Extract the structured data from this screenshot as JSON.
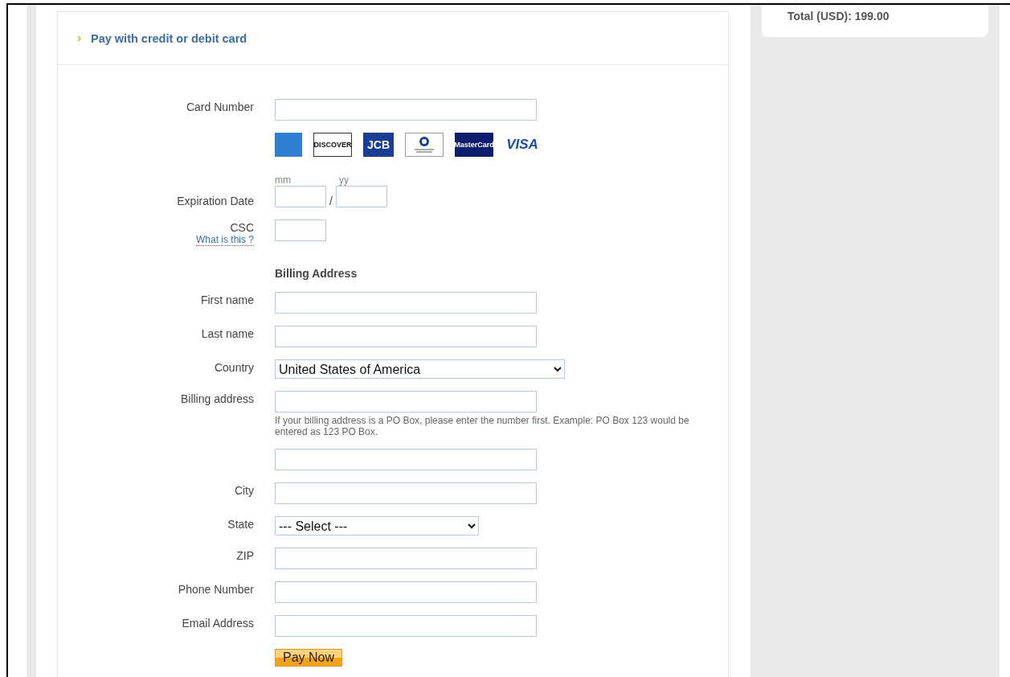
{
  "panel": {
    "title": "Pay with credit or debit card"
  },
  "form": {
    "rows": [
      {
        "kind": "text",
        "label": "Card Number"
      },
      {
        "kind": "logos",
        "logos": [
          {
            "kind": "amex"
          },
          {
            "kind": "discover",
            "text": "DISCOVER"
          },
          {
            "kind": "jcb",
            "text": "JCB"
          },
          {
            "kind": "diners"
          },
          {
            "kind": "mastercard",
            "text": "MasterCard"
          },
          {
            "kind": "visa",
            "text": "VISA"
          }
        ]
      },
      {
        "kind": "expiry",
        "label": "Expiration Date",
        "month_hint": "mm",
        "year_hint": "yy",
        "separator": "/"
      },
      {
        "kind": "csc",
        "label": "CSC",
        "help_link": "What is this ?"
      },
      {
        "kind": "heading",
        "label": "Billing Address"
      },
      {
        "kind": "text",
        "label": "First name"
      },
      {
        "kind": "text",
        "label": "Last name"
      },
      {
        "kind": "country_select",
        "label": "Country",
        "value": "United States of America"
      },
      {
        "kind": "text",
        "label": "Billing address",
        "note": "If your billing address is a PO Box, please enter the number first. Example: PO Box 123 would be entered as 123 PO Box."
      },
      {
        "kind": "text"
      },
      {
        "kind": "text",
        "label": "City"
      },
      {
        "kind": "state_select",
        "label": "State",
        "value": "--- Select ---"
      },
      {
        "kind": "text",
        "label": "ZIP"
      },
      {
        "kind": "text",
        "label": "Phone Number"
      },
      {
        "kind": "text",
        "label": "Email Address"
      },
      {
        "kind": "button",
        "label": "Pay Now"
      }
    ]
  },
  "summary": {
    "total": "Total (USD): 199.00"
  }
}
